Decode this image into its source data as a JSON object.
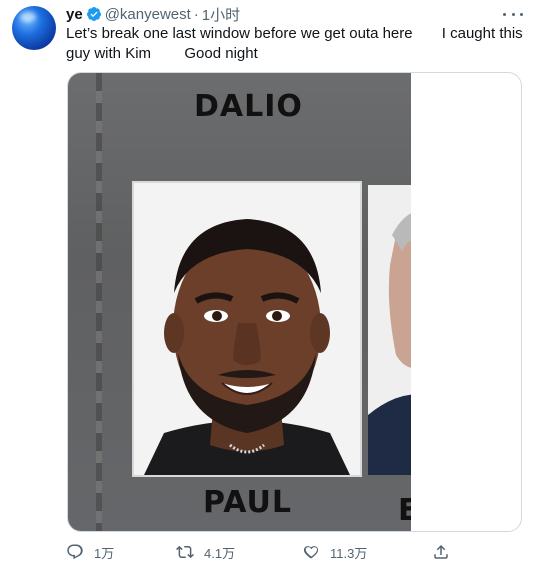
{
  "author": {
    "display_name": "ye",
    "handle": "@kanyewest",
    "time": "1小时",
    "verified_color": "#1d9bf0"
  },
  "tweet": {
    "line1": "Let’s break one last window before we get outa here       I caught this",
    "line2": "guy with Kim        Good night"
  },
  "media": {
    "label_top": "DALIO",
    "label_bottom": "PAUL",
    "label_bottom2": "E"
  },
  "actions": {
    "reply_count": "1万",
    "retweet_count": "4.1万",
    "like_count": "11.3万",
    "reply_icon": "reply-icon",
    "retweet_icon": "retweet-icon",
    "like_icon": "heart-icon",
    "share_icon": "share-icon"
  },
  "colors": {
    "text": "#0f1419",
    "muted": "#536471",
    "border": "#cfd9de"
  }
}
